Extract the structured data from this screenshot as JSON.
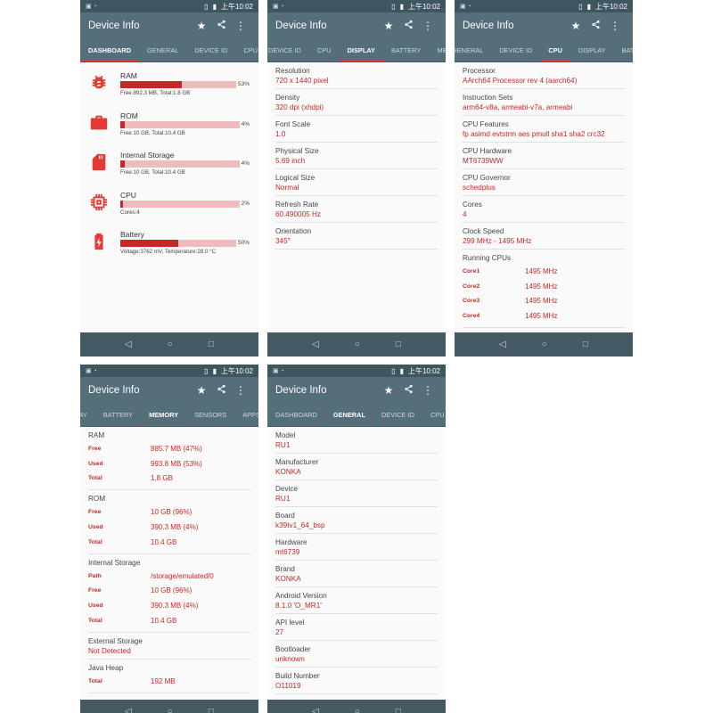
{
  "app_title": "Device Info",
  "status_time": "上午10:02",
  "colors": {
    "toolbar": "#546e7a",
    "status": "#3f5661",
    "accent": "#e53935",
    "value": "#c62828",
    "bar_bg": "#eebcbc"
  },
  "screens": [
    {
      "tabs": [
        "DASHBOARD",
        "GENERAL",
        "DEVICE ID",
        "CPU"
      ],
      "active": 0,
      "dashboard": [
        {
          "title": "RAM",
          "icon": "bug-icon",
          "percent": 53,
          "pct_label": "53%",
          "sub": "Free:892.3 MB,   Total:1.8 GB"
        },
        {
          "title": "ROM",
          "icon": "briefcase-icon",
          "percent": 4,
          "pct_label": "4%",
          "sub": "Free:10 GB,   Total:10.4 GB"
        },
        {
          "title": "Internal Storage",
          "icon": "sd-card-icon",
          "percent": 4,
          "pct_label": "4%",
          "sub": "Free:10 GB,   Total:10.4 GB"
        },
        {
          "title": "CPU",
          "icon": "chip-icon",
          "percent": 2,
          "pct_label": "2%",
          "sub": "Cores:4"
        },
        {
          "title": "Battery",
          "icon": "battery-charging-icon",
          "percent": 50,
          "pct_label": "50%",
          "sub": "Voltage:3762 mV,   Temperature:28.0 °C"
        }
      ]
    },
    {
      "tabs": [
        "DEVICE ID",
        "CPU",
        "DISPLAY",
        "BATTERY",
        "MEMORY"
      ],
      "active": 2,
      "sections": [
        {
          "label": "Resolution",
          "value": "720 x 1440 pixel"
        },
        {
          "label": "Density",
          "value": "320 dpi (xhdpi)"
        },
        {
          "label": "Font Scale",
          "value": "1.0"
        },
        {
          "label": "Physical Size",
          "value": "5.69 inch"
        },
        {
          "label": "Logical Size",
          "value": "Normal"
        },
        {
          "label": "Refresh Rate",
          "value": "60.490005 Hz"
        },
        {
          "label": "Orientation",
          "value": "345°"
        }
      ]
    },
    {
      "tabs": [
        "GENERAL",
        "DEVICE ID",
        "CPU",
        "DISPLAY",
        "BATTERY"
      ],
      "active": 2,
      "sections": [
        {
          "label": "Processor",
          "value": "AArch64 Processor rev 4 (aarch64)"
        },
        {
          "label": "Instruction Sets",
          "value": "arm64-v8a, armeabi-v7a, armeabi"
        },
        {
          "label": "CPU Features",
          "value": "fp asimd evtstrm aes pmull sha1 sha2 crc32"
        },
        {
          "label": "CPU Hardware",
          "value": "MT6739WW"
        },
        {
          "label": "CPU Governor",
          "value": "schedplus"
        },
        {
          "label": "Cores",
          "value": "4"
        },
        {
          "label": "Clock Speed",
          "value": "299 MHz - 1495 MHz"
        },
        {
          "label": "Running CPUs",
          "rows": [
            {
              "k": "Core1",
              "v": "1495 MHz"
            },
            {
              "k": "Core2",
              "v": "1495 MHz"
            },
            {
              "k": "Core3",
              "v": "1495 MHz"
            },
            {
              "k": "Core4",
              "v": "1495 MHz"
            }
          ]
        }
      ]
    },
    {
      "tabs": [
        "DISPLAY",
        "BATTERY",
        "MEMORY",
        "SENSORS",
        "APPS"
      ],
      "active": 2,
      "sections": [
        {
          "label": "RAM",
          "rows": [
            {
              "k": "Free",
              "v": "885.7 MB (47%)"
            },
            {
              "k": "Used",
              "v": "993.8 MB (53%)"
            },
            {
              "k": "Total",
              "v": "1.8 GB"
            }
          ]
        },
        {
          "label": "ROM",
          "rows": [
            {
              "k": "Free",
              "v": "10 GB (96%)"
            },
            {
              "k": "Used",
              "v": "390.3 MB (4%)"
            },
            {
              "k": "Total",
              "v": "10.4 GB"
            }
          ]
        },
        {
          "label": "Internal Storage",
          "rows": [
            {
              "k": "Path",
              "v": "/storage/emulated/0"
            },
            {
              "k": "Free",
              "v": "10 GB (96%)"
            },
            {
              "k": "Used",
              "v": "390.3 MB (4%)"
            },
            {
              "k": "Total",
              "v": "10.4 GB"
            }
          ]
        },
        {
          "label": "External Storage",
          "value": "Not Detected"
        },
        {
          "label": "Java Heap",
          "rows": [
            {
              "k": "Total",
              "v": "192 MB"
            }
          ]
        }
      ]
    },
    {
      "tabs": [
        "DASHBOARD",
        "GENERAL",
        "DEVICE ID",
        "CPU"
      ],
      "active": 1,
      "sections": [
        {
          "label": "Model",
          "value": "RU1"
        },
        {
          "label": "Manufacturer",
          "value": "KONKA"
        },
        {
          "label": "Device",
          "value": "RU1"
        },
        {
          "label": "Board",
          "value": "k39tv1_64_bsp"
        },
        {
          "label": "Hardware",
          "value": "mt6739"
        },
        {
          "label": "Brand",
          "value": "KONKA"
        },
        {
          "label": "Android Version",
          "value": "8.1.0 'O_MR1'"
        },
        {
          "label": "API level",
          "value": "27"
        },
        {
          "label": "Bootloader",
          "value": "unknown"
        },
        {
          "label": "Build Number",
          "value": "O11019"
        }
      ]
    }
  ]
}
